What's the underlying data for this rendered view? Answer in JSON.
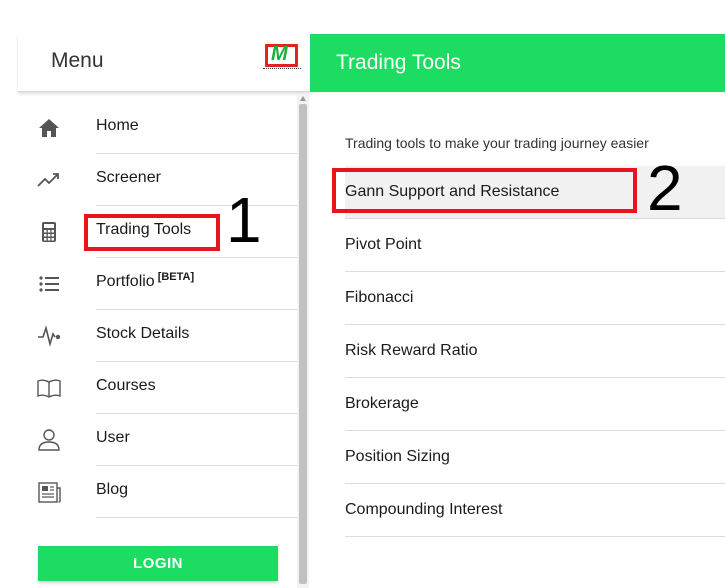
{
  "sidebar": {
    "title": "Menu",
    "logo_letter": "M",
    "items": [
      {
        "label": "Home",
        "icon": "home-icon"
      },
      {
        "label": "Screener",
        "icon": "trending-up-icon"
      },
      {
        "label": "Trading Tools",
        "icon": "calculator-icon"
      },
      {
        "label": "Portfolio",
        "badge": "[BETA]",
        "icon": "list-icon"
      },
      {
        "label": "Stock Details",
        "icon": "pulse-icon"
      },
      {
        "label": "Courses",
        "icon": "book-icon"
      },
      {
        "label": "User",
        "icon": "user-icon"
      },
      {
        "label": "Blog",
        "icon": "newspaper-icon"
      }
    ],
    "login_label": "LOGIN"
  },
  "main": {
    "title": "Trading Tools",
    "subtitle": "Trading tools to make your trading journey easier",
    "tools": [
      "Gann Support and Resistance",
      "Pivot Point",
      "Fibonacci",
      "Risk Reward Ratio",
      "Brokerage",
      "Position Sizing",
      "Compounding Interest"
    ]
  },
  "annotations": {
    "marker_1": "1",
    "marker_2": "2",
    "highlight_color": "#e8141b"
  },
  "colors": {
    "accent": "#1ddc62"
  }
}
